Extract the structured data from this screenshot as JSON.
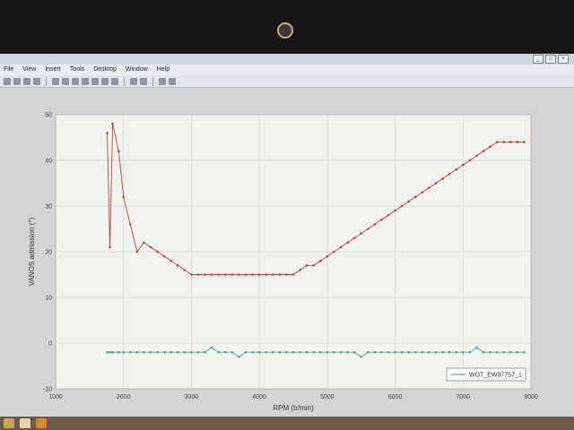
{
  "window": {
    "menus": [
      "File",
      "View",
      "Insert",
      "Tools",
      "Desktop",
      "Window",
      "Help"
    ],
    "controls": [
      "_",
      "□",
      "×"
    ]
  },
  "colors": {
    "series_red": "#b5483a",
    "series_teal": "#4aa3a3",
    "plot_bg": "#f2f2ef",
    "grid": "#d2d2cf"
  },
  "chart_data": {
    "type": "line",
    "xlabel": "RPM (tr/min)",
    "ylabel": "VANOS admission (°)",
    "xlim": [
      1000,
      8000
    ],
    "ylim": [
      -10,
      50
    ],
    "xticks": [
      1000,
      2000,
      3000,
      4000,
      5000,
      6000,
      7000,
      8000
    ],
    "yticks": [
      50,
      40,
      30,
      20,
      10,
      0,
      -10
    ],
    "grid": true,
    "legend_position": "bottom-right",
    "legend_entries": [
      "WOT_EW37757_1"
    ],
    "series": [
      {
        "color": "#b5483a",
        "x": [
          1760,
          1800,
          1840,
          1930,
          2000,
          2100,
          2200,
          2300,
          2400,
          2500,
          2600,
          2700,
          2800,
          2900,
          3000,
          3100,
          3200,
          3300,
          3400,
          3500,
          3600,
          3700,
          3800,
          3900,
          4000,
          4100,
          4200,
          4300,
          4400,
          4500,
          4600,
          4700,
          4800,
          4900,
          5000,
          5100,
          5200,
          5300,
          5400,
          5500,
          5600,
          5700,
          5800,
          5900,
          6000,
          6100,
          6200,
          6300,
          6400,
          6500,
          6600,
          6700,
          6800,
          6900,
          7000,
          7100,
          7200,
          7300,
          7400,
          7500,
          7600,
          7700,
          7800,
          7900
        ],
        "y": [
          46,
          21,
          48,
          42,
          32,
          26,
          20,
          22,
          21,
          20,
          19,
          18,
          17,
          16,
          15,
          15,
          15,
          15,
          15,
          15,
          15,
          15,
          15,
          15,
          15,
          15,
          15,
          15,
          15,
          15,
          16,
          17,
          17,
          18,
          19,
          20,
          21,
          22,
          23,
          24,
          25,
          26,
          27,
          28,
          29,
          30,
          31,
          32,
          33,
          34,
          35,
          36,
          37,
          38,
          39,
          40,
          41,
          42,
          43,
          44,
          44,
          44,
          44,
          44
        ]
      },
      {
        "name": "WOT_EW37757_1",
        "color": "#4aa3a3",
        "x": [
          1760,
          1800,
          1840,
          1930,
          2000,
          2100,
          2200,
          2300,
          2400,
          2500,
          2600,
          2700,
          2800,
          2900,
          3000,
          3100,
          3200,
          3300,
          3400,
          3500,
          3600,
          3700,
          3800,
          3900,
          4000,
          4100,
          4200,
          4300,
          4400,
          4500,
          4600,
          4700,
          4800,
          4900,
          5000,
          5100,
          5200,
          5300,
          5400,
          5500,
          5600,
          5700,
          5800,
          5900,
          6000,
          6100,
          6200,
          6300,
          6400,
          6500,
          6600,
          6700,
          6800,
          6900,
          7000,
          7100,
          7200,
          7300,
          7400,
          7500,
          7600,
          7700,
          7800,
          7900
        ],
        "y": [
          -2,
          -2,
          -2,
          -2,
          -2,
          -2,
          -2,
          -2,
          -2,
          -2,
          -2,
          -2,
          -2,
          -2,
          -2,
          -2,
          -2,
          -1,
          -2,
          -2,
          -2,
          -3,
          -2,
          -2,
          -2,
          -2,
          -2,
          -2,
          -2,
          -2,
          -2,
          -2,
          -2,
          -2,
          -2,
          -2,
          -2,
          -2,
          -2,
          -3,
          -2,
          -2,
          -2,
          -2,
          -2,
          -2,
          -2,
          -2,
          -2,
          -2,
          -2,
          -2,
          -2,
          -2,
          -2,
          -2,
          -1,
          -2,
          -2,
          -2,
          -2,
          -2,
          -2,
          -2
        ]
      }
    ]
  }
}
